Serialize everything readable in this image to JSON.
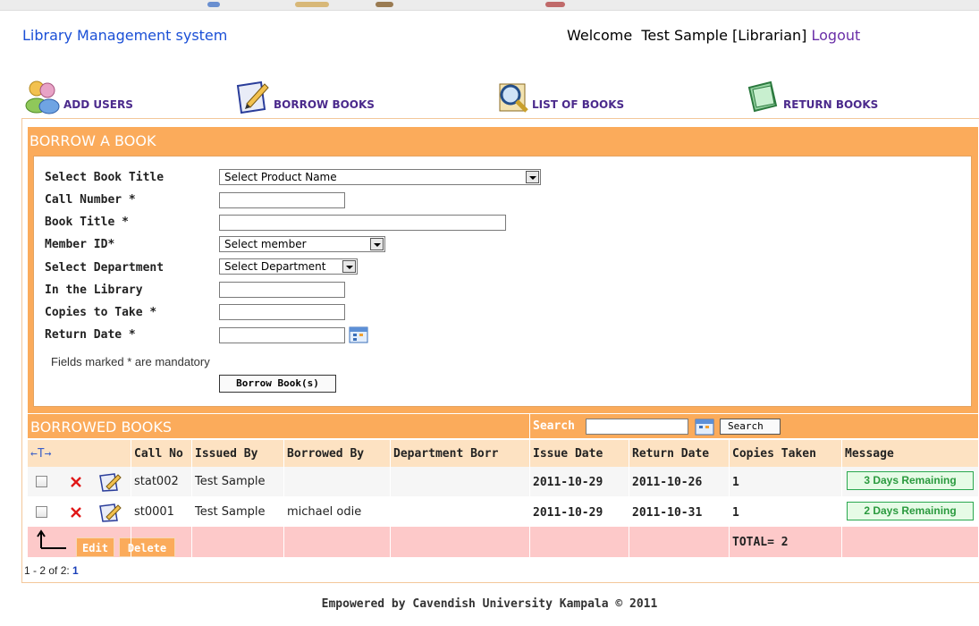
{
  "header": {
    "app_title": "Library Management system",
    "welcome_text": "Welcome  Test Sample [Librarian]",
    "logout_label": "Logout"
  },
  "nav": {
    "items": [
      {
        "label": "ADD USERS",
        "icon": "users-icon"
      },
      {
        "label": "BORROW BOOKS",
        "icon": "edit-note-icon"
      },
      {
        "label": "LIST OF BOOKS",
        "icon": "magnifier-list-icon"
      },
      {
        "label": "RETURN BOOKS",
        "icon": "book-return-icon"
      }
    ]
  },
  "borrow_form": {
    "title": "BORROW A BOOK",
    "fields": {
      "book_title_select": {
        "label": "Select Book Title",
        "value": "Select Product Name"
      },
      "call_number": {
        "label": "Call Number *",
        "value": ""
      },
      "book_title": {
        "label": "Book Title *",
        "value": ""
      },
      "member_id": {
        "label": "Member ID*",
        "value": "Select member"
      },
      "department": {
        "label": "Select Department",
        "value": "Select Department"
      },
      "in_library": {
        "label": "In the Library",
        "value": ""
      },
      "copies": {
        "label": "Copies to Take *",
        "value": ""
      },
      "return_date": {
        "label": "Return Date *",
        "value": ""
      }
    },
    "mandatory_note": "Fields marked * are mandatory",
    "submit_label": "Borrow Book(s)"
  },
  "borrowed": {
    "title": "BORROWED BOOKS",
    "search_label": "Search",
    "search_value": "",
    "search_button": "Search",
    "sort_glyph": "←T→",
    "columns": [
      "Call No",
      "Issued By",
      "Borrowed By",
      "Department Borr",
      "Issue Date",
      "Return Date",
      "Copies Taken",
      "Message"
    ],
    "rows": [
      {
        "call_no": "stat002",
        "issued_by": "Test Sample",
        "borrowed_by": "",
        "department": "",
        "issue_date": "2011-10-29",
        "return_date": "2011-10-26",
        "copies": "1",
        "message": "3 Days Remaining"
      },
      {
        "call_no": "st0001",
        "issued_by": "Test Sample",
        "borrowed_by": "michael odie",
        "department": "",
        "issue_date": "2011-10-29",
        "return_date": "2011-10-31",
        "copies": "1",
        "message": "2 Days Remaining"
      }
    ],
    "edit_label": "Edit",
    "delete_label": "Delete",
    "total_text": "TOTAL= 2",
    "pager_text": "1 - 2 of 2:",
    "pager_page": "1"
  },
  "footer": {
    "text": "Empowered by Cavendish University Kampala © 2011"
  },
  "colors": {
    "accent_orange": "#fbab5b",
    "title_blue": "#1a4fd6",
    "nav_purple": "#4b2a8c",
    "row_pink": "#fdc9c9",
    "badge_green": "#2a9a3e"
  }
}
